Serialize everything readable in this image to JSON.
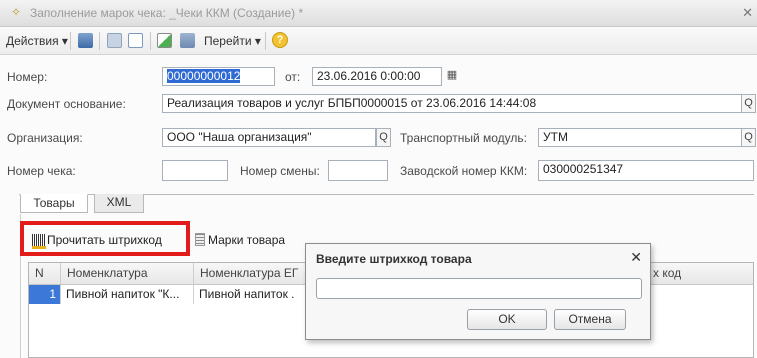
{
  "window": {
    "title": "Заполнение марок чека: _Чеки ККМ (Создание) *",
    "close_glyph": "✕"
  },
  "toolbar": {
    "actions_label": "Действия",
    "goto_label": "Перейти",
    "dropdown_glyph": "▾",
    "help_glyph": "?"
  },
  "form": {
    "number_label": "Номер:",
    "number_value": "00000000012",
    "from_label": "от:",
    "date_value": "23.06.2016  0:00:00",
    "base_doc_label": "Документ основание:",
    "base_doc_value": "Реализация товаров и услуг БПБП0000015 от 23.06.2016 14:44:08",
    "org_label": "Организация:",
    "org_value": "ООО \"Наша организация\"",
    "transport_label": "Транспортный модуль:",
    "transport_value": "УТМ",
    "receipt_no_label": "Номер чека:",
    "receipt_no_value": "",
    "shift_no_label": "Номер смены:",
    "shift_no_value": "",
    "kkm_serial_label": "Заводской номер ККМ:",
    "kkm_serial_value": "030000251347",
    "search_glyph": "Q"
  },
  "tabs": [
    {
      "label": "Товары"
    },
    {
      "label": "XML"
    }
  ],
  "panel_toolbar": {
    "read_barcode_label": "Прочитать штрихкод",
    "marks_label": "Марки товара"
  },
  "grid": {
    "columns": [
      "N",
      "Номенклатура",
      "Номенклатура ЕГ",
      "х код"
    ],
    "rows": [
      {
        "n": "1",
        "item": "Пивной напиток \"К...",
        "item_egais": "Пивной напиток ."
      }
    ]
  },
  "dialog": {
    "title": "Введите штрихкод товара",
    "close_glyph": "✕",
    "input_value": "",
    "ok_label": "OK",
    "cancel_label": "Отмена"
  },
  "colors": {
    "highlight": "#e21b1b",
    "selection": "#2f6bd3",
    "row_number_bg": "#3c78d8"
  }
}
